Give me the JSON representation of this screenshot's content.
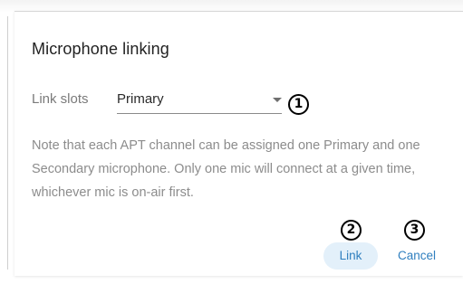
{
  "dialog": {
    "title": "Microphone linking",
    "link_slots": {
      "label": "Link slots",
      "selected_value": "Primary"
    },
    "note": "Note that each APT channel can be assigned one Primary and one Secondary microphone. Only one mic will connect at a given time, whichever mic is on-air first.",
    "buttons": {
      "link": "Link",
      "cancel": "Cancel"
    }
  },
  "annotations": {
    "marker_1": "1",
    "marker_2": "2",
    "marker_3": "3"
  },
  "colors": {
    "accent": "#2f7fbf",
    "link_button_bg": "#e3f0fa",
    "title_text": "#222222",
    "muted_text": "#8c8c8c"
  }
}
